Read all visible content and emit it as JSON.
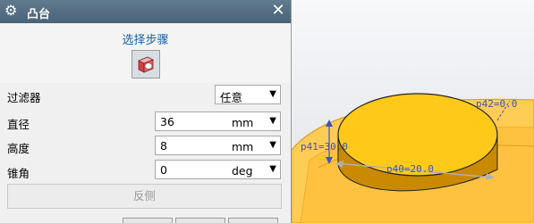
{
  "dialog": {
    "title": "凸台",
    "step_label": "选择步骤"
  },
  "fields": {
    "filter_label": "过滤器",
    "filter_value": "任意",
    "diameter_label": "直径",
    "diameter_value": "36",
    "diameter_unit": "mm",
    "height_label": "高度",
    "height_value": "8",
    "height_unit": "mm",
    "taper_label": "锥角",
    "taper_value": "0",
    "taper_unit": "deg"
  },
  "reverse_button_label": "反侧",
  "viewport": {
    "dim_p40": "p40=20.0",
    "dim_p41": "p41=30.0",
    "dim_p42": "p42=0.0"
  },
  "colors": {
    "boss_top": "#ffc91a",
    "boss_side": "#c98a00",
    "base_face": "#ffc84a",
    "dimension": "#3f55b8"
  }
}
